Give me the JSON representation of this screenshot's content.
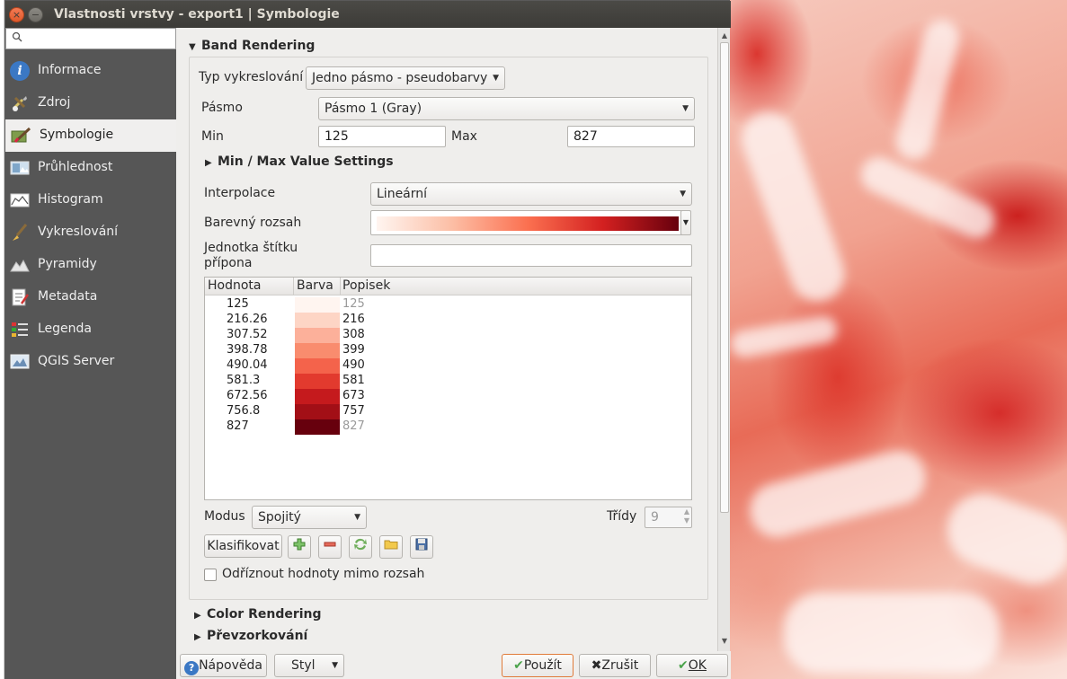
{
  "window": {
    "title": "Vlastnosti vrstvy - export1 | Symbologie",
    "close_glyph": "×",
    "min_glyph": "−"
  },
  "sidebar": {
    "search_placeholder": "",
    "items": [
      {
        "label": "Informace",
        "icon": "info-icon"
      },
      {
        "label": "Zdroj",
        "icon": "source-icon"
      },
      {
        "label": "Symbologie",
        "icon": "symbology-icon",
        "active": true
      },
      {
        "label": "Průhlednost",
        "icon": "transparency-icon"
      },
      {
        "label": "Histogram",
        "icon": "histogram-icon"
      },
      {
        "label": "Vykreslování",
        "icon": "rendering-icon"
      },
      {
        "label": "Pyramidy",
        "icon": "pyramids-icon"
      },
      {
        "label": "Metadata",
        "icon": "metadata-icon"
      },
      {
        "label": "Legenda",
        "icon": "legend-icon"
      },
      {
        "label": "QGIS Server",
        "icon": "server-icon"
      }
    ]
  },
  "band_rendering": {
    "header": "Band Rendering",
    "render_type_label": "Typ vykreslování",
    "render_type_value": "Jedno pásmo - pseudobarvy",
    "band_label": "Pásmo",
    "band_value": "Pásmo 1 (Gray)",
    "min_label": "Min",
    "min_value": "125",
    "max_label": "Max",
    "max_value": "827",
    "minmax_header": "Min / Max Value Settings",
    "interpolation_label": "Interpolace",
    "interpolation_value": "Lineární",
    "ramp_label": "Barevný rozsah",
    "unit_label_line1": "Jednotka štítku",
    "unit_label_line2": "přípona",
    "unit_value": "",
    "table": {
      "headers": [
        "Hodnota",
        "Barva",
        "Popisek"
      ],
      "rows": [
        {
          "value": "125",
          "color": "#fff5f0",
          "label": "125",
          "dim": true
        },
        {
          "value": "216.26",
          "color": "#fdd5c5",
          "label": "216",
          "dim": false
        },
        {
          "value": "307.52",
          "color": "#fcb09a",
          "label": "308",
          "dim": false
        },
        {
          "value": "398.78",
          "color": "#f98c6e",
          "label": "399",
          "dim": false
        },
        {
          "value": "490.04",
          "color": "#f4634b",
          "label": "490",
          "dim": false
        },
        {
          "value": "581.3",
          "color": "#e23a2e",
          "label": "581",
          "dim": false
        },
        {
          "value": "672.56",
          "color": "#c51a1d",
          "label": "673",
          "dim": false
        },
        {
          "value": "756.8",
          "color": "#a20f16",
          "label": "757",
          "dim": false
        },
        {
          "value": "827",
          "color": "#67000d",
          "label": "827",
          "dim": true
        }
      ]
    },
    "mode_label": "Modus",
    "mode_value": "Spojitý",
    "classes_label": "Třídy",
    "classes_value": "9",
    "classify_button": "Klasifikovat",
    "clip_label": "Odříznout hodnoty mimo rozsah"
  },
  "sections": {
    "color_rendering": "Color Rendering",
    "resampling": "Převzorkování"
  },
  "buttons": {
    "help": "Nápověda",
    "style": "Styl",
    "apply": "Použít",
    "cancel": "Zrušit",
    "ok": "OK"
  }
}
